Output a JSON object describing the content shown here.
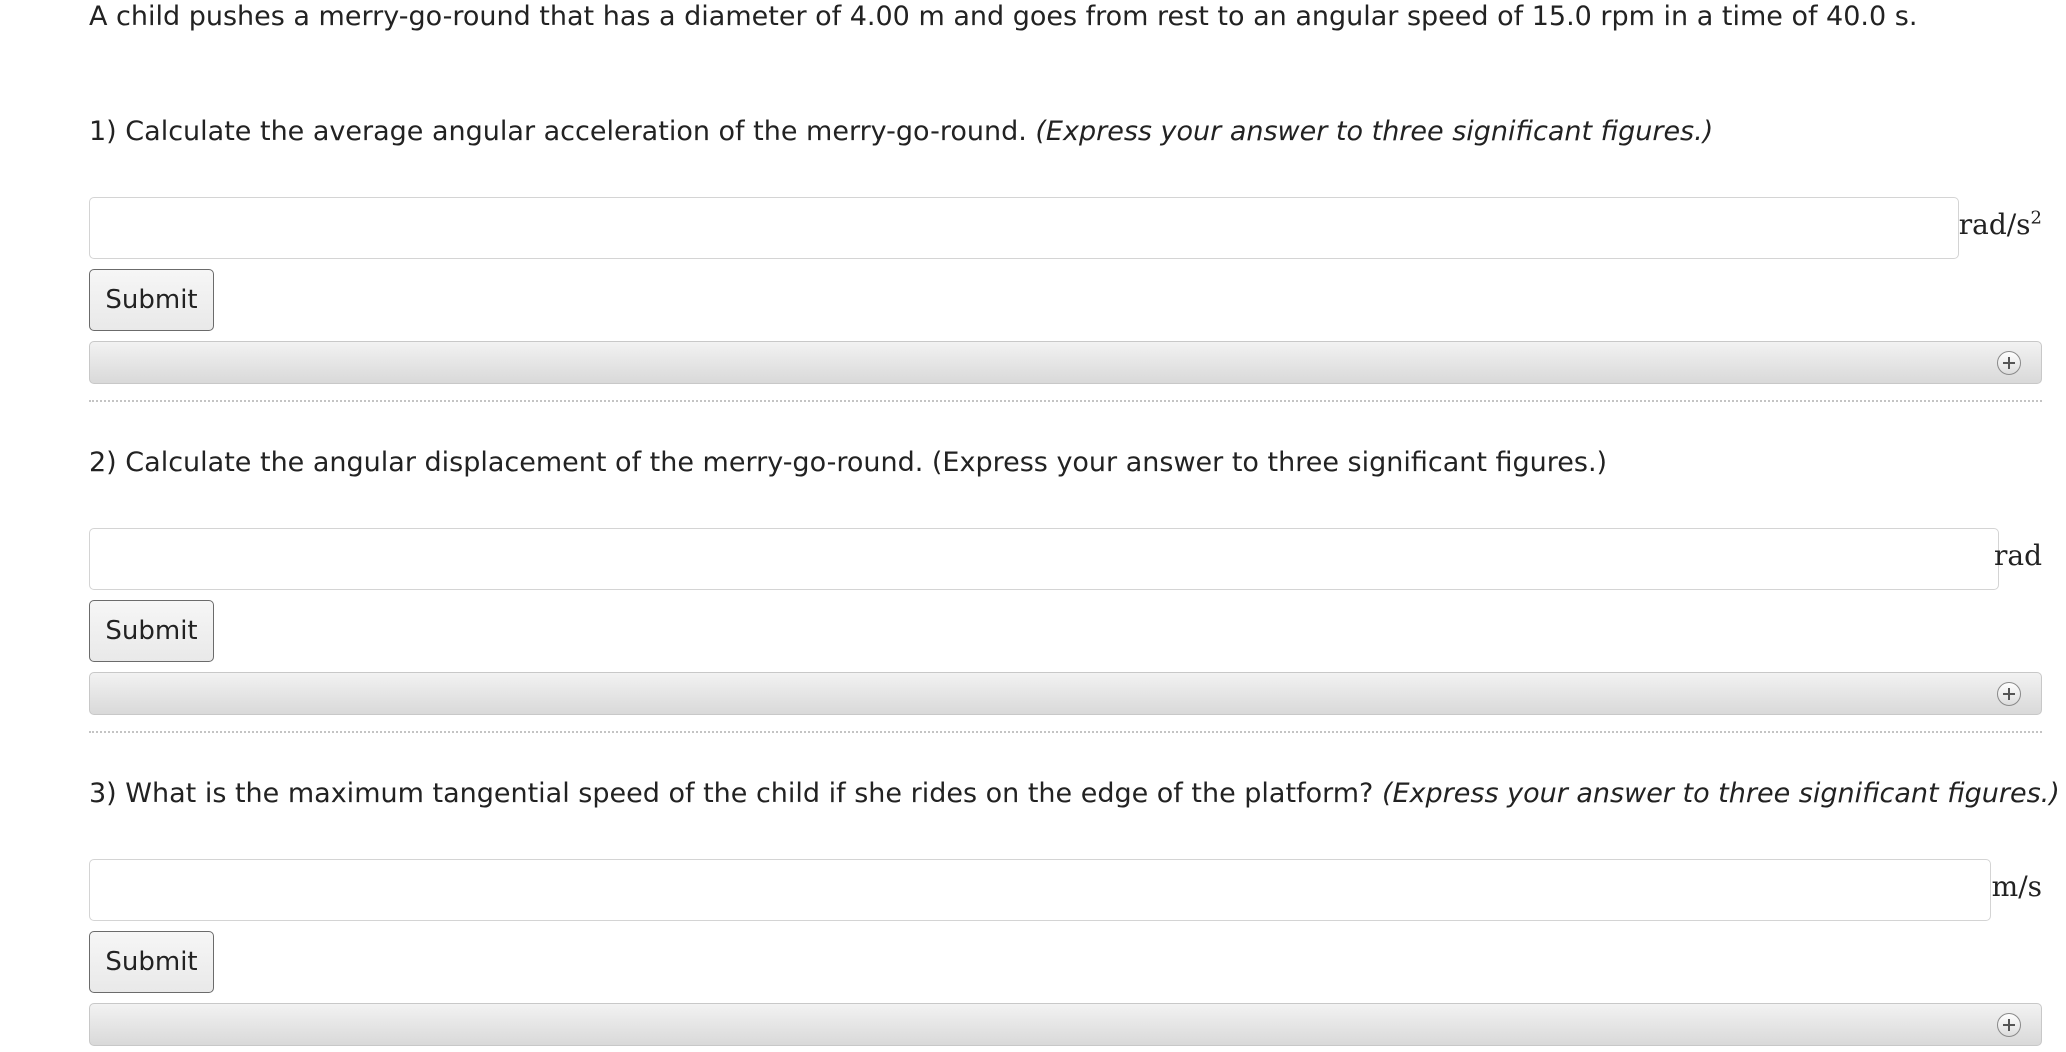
{
  "intro": "A child pushes a merry-go-round that has a diameter of 4.00 m and goes from rest to an angular speed of 15.0 rpm in a time of 40.0 s.",
  "questions": [
    {
      "text": "1) Calculate the average angular acceleration of the merry-go-round.",
      "note": "(Express your answer to three significant figures.)",
      "unit_base": "rad/s",
      "unit_sup": "2",
      "answer_value": "",
      "submit_label": "Submit"
    },
    {
      "text": "2) Calculate the angular displacement of the merry-go-round. (Express your answer to three significant figures.)",
      "note": "",
      "unit_base": "rad",
      "unit_sup": "",
      "answer_value": "",
      "submit_label": "Submit"
    },
    {
      "text": "3) What is the maximum tangential speed of the child if she rides on the edge of the platform?",
      "note": "(Express your answer to three significant figures.)",
      "unit_base": "m/s",
      "unit_sup": "",
      "answer_value": "",
      "submit_label": "Submit"
    }
  ],
  "icons": {
    "expand": "plus-circle-icon"
  }
}
